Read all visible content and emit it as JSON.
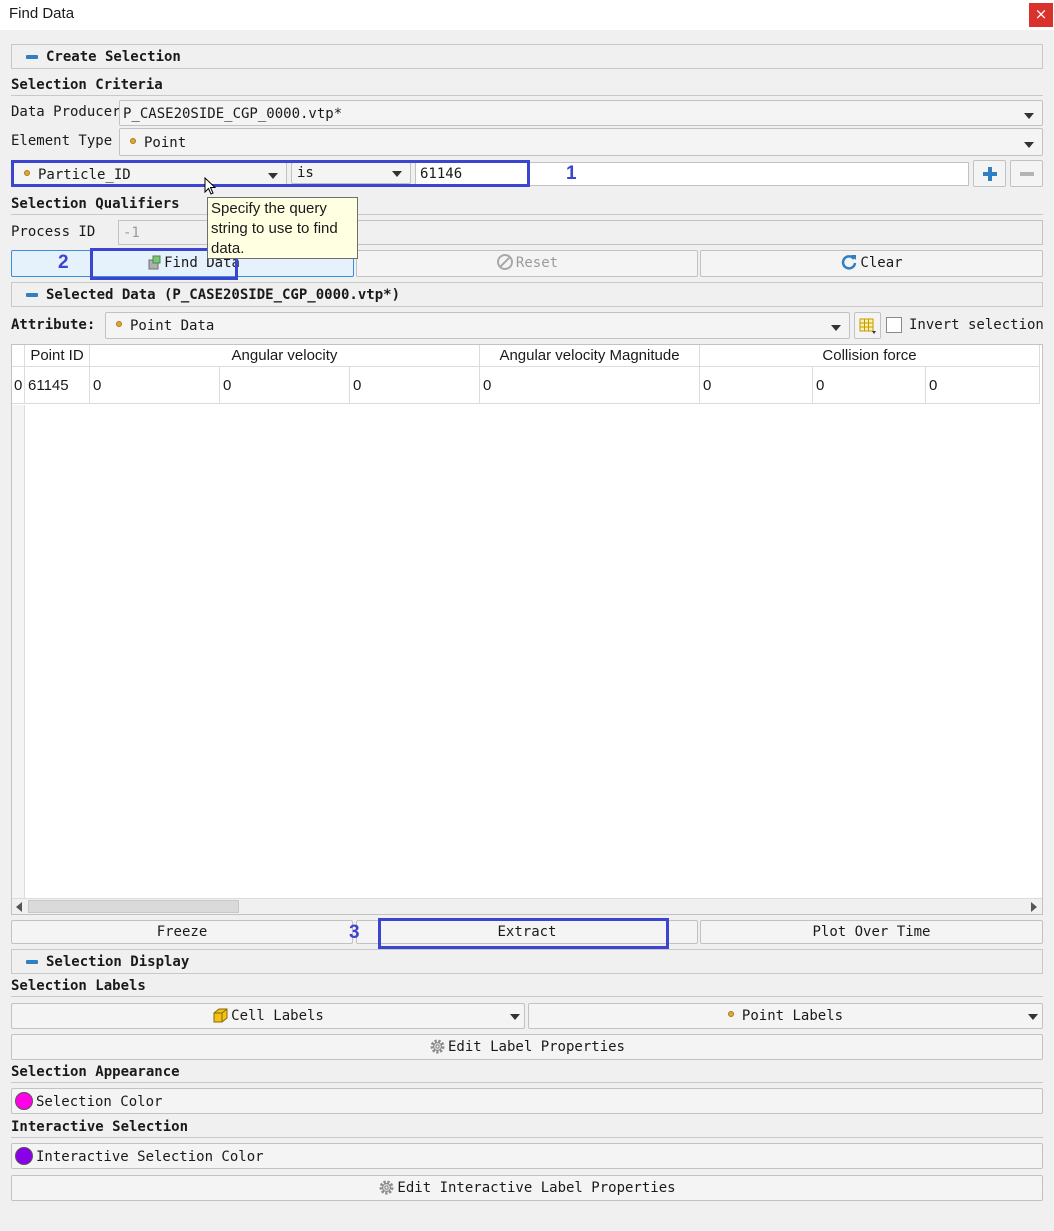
{
  "window": {
    "title": "Find Data",
    "close": "×"
  },
  "create_selection": {
    "header": "Create Selection",
    "criteria_header": "Selection Criteria",
    "data_producer_label": "Data Producer",
    "data_producer_value": "P_CASE20SIDE_CGP_0000.vtp*",
    "element_type_label": "Element Type",
    "element_type_value": "Point",
    "query": {
      "field": "Particle_ID",
      "operator": "is",
      "value": "61146"
    },
    "qualifiers_header": "Selection Qualifiers",
    "process_id_label": "Process ID",
    "process_id_placeholder": "-1",
    "tooltip": "Specify the query string to use to find data.",
    "buttons": {
      "find": "Find Data",
      "reset": "Reset",
      "clear": "Clear"
    }
  },
  "annotations": {
    "one": "1",
    "two": "2",
    "three": "3"
  },
  "selected_data": {
    "header": "Selected Data (P_CASE20SIDE_CGP_0000.vtp*)",
    "attribute_label": "Attribute:",
    "attribute_value": "Point Data",
    "invert_label": "Invert selection",
    "columns": [
      "Point ID",
      "Angular velocity",
      "Angular velocity Magnitude",
      "Collision force"
    ],
    "rows": [
      {
        "index": "0",
        "cells": [
          "61145",
          "0",
          "0",
          "0",
          "0",
          "0",
          "0",
          "0"
        ]
      }
    ],
    "buttons": {
      "freeze": "Freeze",
      "extract": "Extract",
      "plot": "Plot Over Time"
    }
  },
  "selection_display": {
    "header": "Selection Display",
    "labels_header": "Selection Labels",
    "cell_labels": "Cell Labels",
    "point_labels": "Point Labels",
    "edit_label_props": "Edit Label Properties",
    "appearance_header": "Selection Appearance",
    "selection_color": "Selection Color",
    "selection_color_hex": "#ff00e6",
    "interactive_header": "Interactive Selection",
    "interactive_color": "Interactive Selection Color",
    "interactive_color_hex": "#8a00e8",
    "edit_interactive_props": "Edit Interactive Label Properties"
  }
}
